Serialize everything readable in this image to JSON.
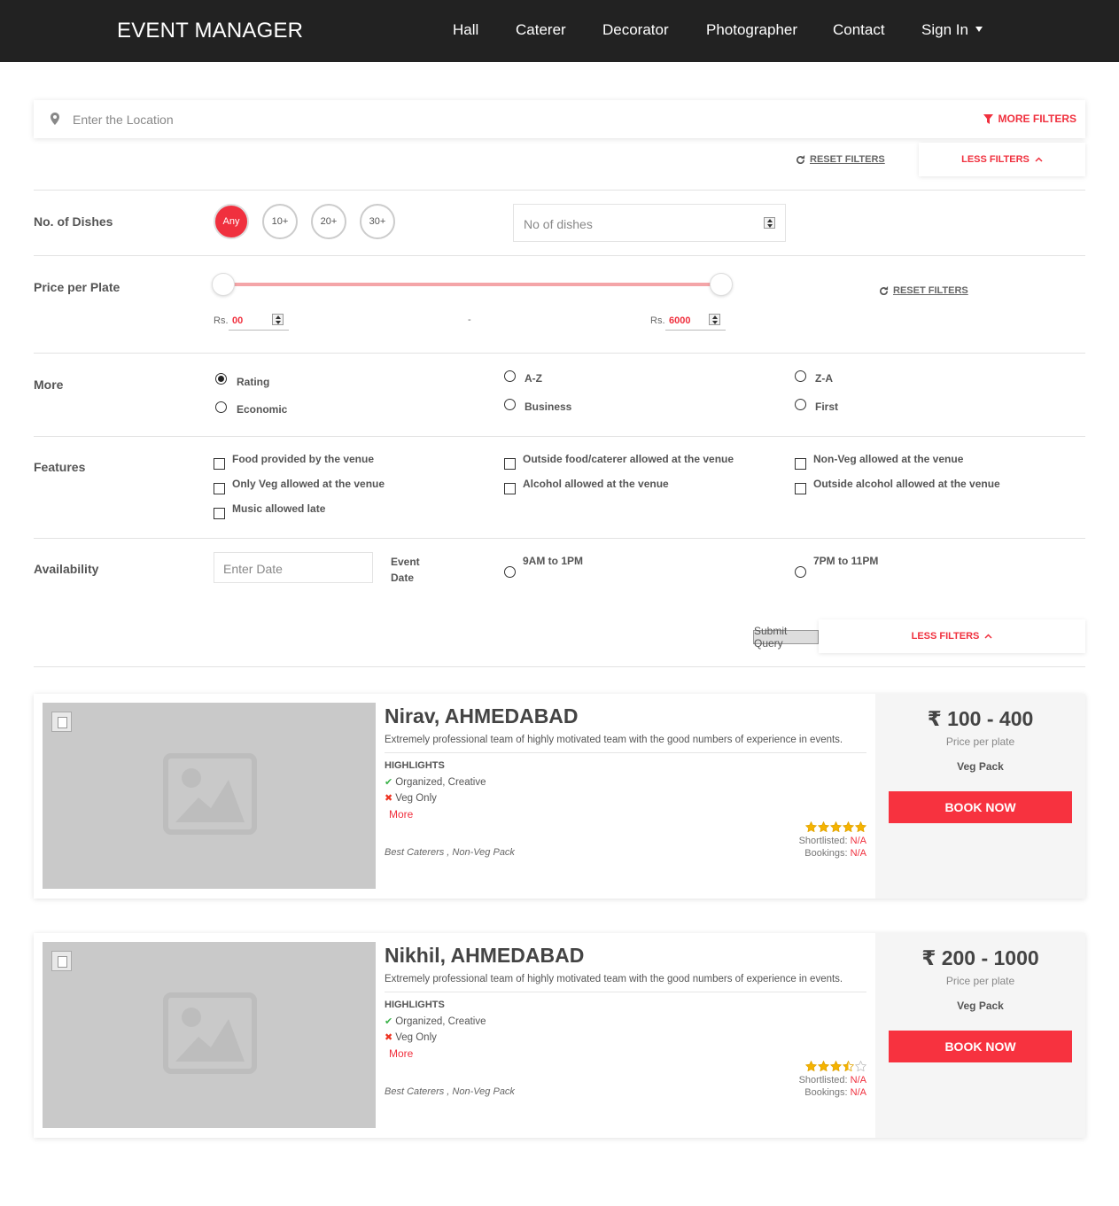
{
  "nav": {
    "brand": "EVENT MANAGER",
    "items": [
      "Hall",
      "Caterer",
      "Decorator",
      "Photographer",
      "Contact",
      "Sign In"
    ]
  },
  "search": {
    "placeholder": "Enter the Location",
    "more_filters": "MORE FILTERS",
    "reset_filters": "RESET FILTERS",
    "less_filters": "LESS FILTERS"
  },
  "dishes": {
    "label": "No. of Dishes",
    "options": [
      "Any",
      "10+",
      "20+",
      "30+"
    ],
    "selected": "Any",
    "input_placeholder": "No of dishes"
  },
  "price": {
    "label": "Price per Plate",
    "currency_label": "Rs.",
    "min": "00",
    "max": "6000",
    "separator": "-",
    "reset_filters": "RESET FILTERS",
    "range_min_fraction": 0,
    "range_max_fraction": 1
  },
  "more": {
    "label": "More",
    "options": [
      "Rating",
      "A-Z",
      "Z-A",
      "Economic",
      "Business",
      "First"
    ],
    "selected": "Rating"
  },
  "features": {
    "label": "Features",
    "options": [
      "Food provided by the venue",
      "Outside food/caterer allowed at the venue",
      "Non-Veg allowed at the venue",
      "Only Veg allowed at the venue",
      "Alcohol allowed at the venue",
      "Outside alcohol allowed at the venue",
      "Music allowed late"
    ]
  },
  "availability": {
    "label": "Availability",
    "date_placeholder": "Enter Date",
    "event_date_label": "Event Date",
    "slots": [
      "9AM to 1PM",
      "7PM to 11PM"
    ]
  },
  "actions": {
    "submit": "Submit Query",
    "less_filters": "LESS FILTERS"
  },
  "listings": [
    {
      "title": "Nirav, AHMEDABAD",
      "description": "Extremely professional team of highly motivated team with the good numbers of experience in events.",
      "highlights_title": "HIGHLIGHTS",
      "highlight_yes": "Organized, Creative",
      "highlight_no": "Veg Only",
      "more": "More",
      "tags": "Best Caterers , Non-Veg Pack",
      "rating": 5,
      "shortlisted_label": "Shortlisted:",
      "shortlisted": "N/A",
      "bookings_label": "Bookings:",
      "bookings": "N/A",
      "price_range": "₹ 100 - 400",
      "price_sub": "Price per plate",
      "pack": "Veg Pack",
      "book": "BOOK NOW"
    },
    {
      "title": "Nikhil, AHMEDABAD",
      "description": "Extremely professional team of highly motivated team with the good numbers of experience in events.",
      "highlights_title": "HIGHLIGHTS",
      "highlight_yes": "Organized, Creative",
      "highlight_no": "Veg Only",
      "more": "More",
      "tags": "Best Caterers , Non-Veg Pack",
      "rating": 3.5,
      "shortlisted_label": "Shortlisted:",
      "shortlisted": "N/A",
      "bookings_label": "Bookings:",
      "bookings": "N/A",
      "price_range": "₹ 200 - 1000",
      "price_sub": "Price per plate",
      "pack": "Veg Pack",
      "book": "BOOK NOW"
    }
  ],
  "colors": {
    "accent": "#f0303e",
    "navbar": "#222222",
    "star": "#f5b301",
    "check": "#3cb34a"
  }
}
